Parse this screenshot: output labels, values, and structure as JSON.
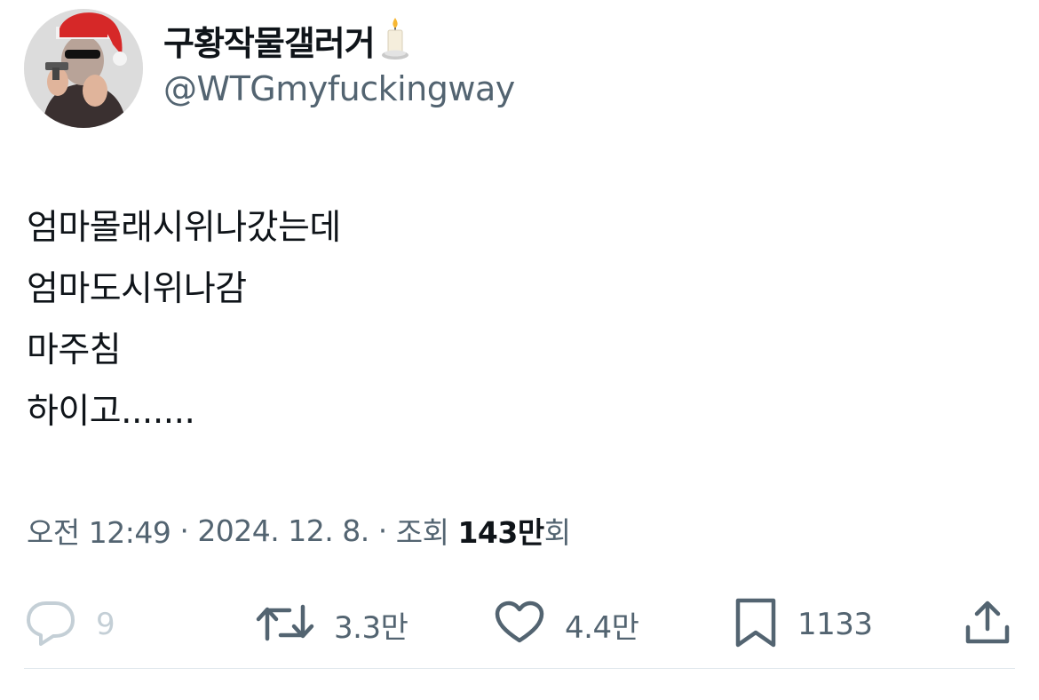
{
  "author": {
    "display_name": "구황작물갤러거",
    "display_name_emoji": "candle-icon",
    "handle": "@WTGmyfuckingway",
    "avatar_icon": "avatar-santa-hat"
  },
  "tweet": {
    "lines": [
      "엄마몰래시위나갔는데",
      "엄마도시위나감",
      "마주침",
      "하이고......."
    ]
  },
  "meta": {
    "time": "오전 12:49",
    "separator": "·",
    "date": "2024. 12. 8.",
    "views_label": "조회",
    "views_count": "143만",
    "views_suffix": "회"
  },
  "actions": {
    "reply": {
      "icon": "reply-icon",
      "count": "9"
    },
    "retweet": {
      "icon": "retweet-icon",
      "count": "3.3만"
    },
    "like": {
      "icon": "heart-icon",
      "count": "4.4만"
    },
    "bookmark": {
      "icon": "bookmark-icon",
      "count": "1133"
    },
    "share": {
      "icon": "share-icon"
    }
  },
  "colors": {
    "text_primary": "#0f1419",
    "text_secondary": "#536471",
    "reply_muted": "#c4cfd6",
    "divider": "#e1e8ed",
    "hat_red": "#d62828"
  }
}
